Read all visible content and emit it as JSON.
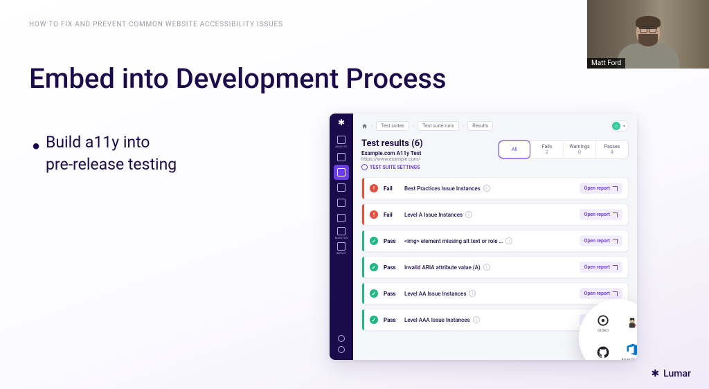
{
  "slide": {
    "header": "HOW TO FIX AND PREVENT COMMON WEBSITE ACCESSIBILITY ISSUES",
    "title": "Embed into Development Process",
    "bullet_line1": "Build a11y into",
    "bullet_line2": "pre-release testing"
  },
  "webcam": {
    "name": "Matt Ford"
  },
  "brand": {
    "name": "Lumar"
  },
  "app": {
    "breadcrumbs": {
      "items": [
        "Test suites",
        "Test suite runs",
        "Results"
      ]
    },
    "sidebar": {
      "items": [
        {
          "label": "ANALYZE"
        },
        {
          "label": ""
        },
        {
          "label": ""
        },
        {
          "label": ""
        },
        {
          "label": ""
        },
        {
          "label": ""
        },
        {
          "label": "MONITOR"
        },
        {
          "label": "IMPACT"
        }
      ],
      "active_index": 2
    },
    "header": {
      "title": "Test results (6)",
      "subtitle": "Example.com A11y Test",
      "url": "https://www.example.com/",
      "settings_link": "TEST SUITE SETTINGS"
    },
    "tabs": [
      {
        "label": "All",
        "count": ""
      },
      {
        "label": "Fails",
        "count": "2"
      },
      {
        "label": "Warnings",
        "count": "0"
      },
      {
        "label": "Passes",
        "count": "4"
      }
    ],
    "active_tab": 0,
    "open_report_label": "Open report",
    "rows": [
      {
        "status": "fail",
        "status_label": "Fail",
        "title": "Best Practices Issue Instances"
      },
      {
        "status": "fail",
        "status_label": "Fail",
        "title": "Level A Issue Instances"
      },
      {
        "status": "pass",
        "status_label": "Pass",
        "title": "<img> element missing alt text or role …"
      },
      {
        "status": "pass",
        "status_label": "Pass",
        "title": "Invalid ARIA attribute value (A)"
      },
      {
        "status": "pass",
        "status_label": "Pass",
        "title": "Level AA Issue Instances"
      },
      {
        "status": "pass",
        "status_label": "Pass",
        "title": "Level AAA Issue Instances"
      }
    ],
    "integrations": [
      {
        "name": "circleci"
      },
      {
        "name": "Jenkins",
        "hide_label": true
      },
      {
        "name": "GitHub",
        "hide_label": true
      },
      {
        "name": "Azure DevOps"
      }
    ]
  }
}
